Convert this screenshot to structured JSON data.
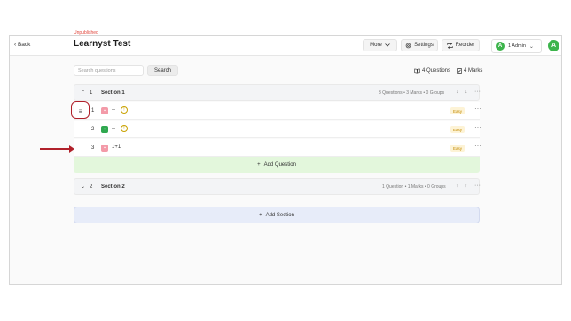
{
  "topbar": {
    "back_label": "‹ Back",
    "admin_initial": "A",
    "admin_label": "1 Admin",
    "admin_chevron": "⌄",
    "user_initial": "A"
  },
  "test": {
    "status": "Unpublished",
    "title": "Learnyst Test"
  },
  "toolbar": {
    "more_label": "More",
    "settings_label": "Settings",
    "reorder_label": "Reorder"
  },
  "search": {
    "placeholder": "Search questions",
    "button_label": "Search"
  },
  "summary": {
    "questions": "4 Questions",
    "marks": "4 Marks"
  },
  "sections": [
    {
      "number": "1",
      "name": "Section 1",
      "meta": "3 Questions • 3 Marks • 0 Groups",
      "questions": [
        {
          "number": "1",
          "type_icon": "pink-question-icon",
          "text": "--",
          "has_warning": true,
          "difficulty": "Easy"
        },
        {
          "number": "2",
          "type_icon": "green-question-icon",
          "text": "--",
          "has_warning": true,
          "difficulty": "Easy"
        },
        {
          "number": "3",
          "type_icon": "pink-question-icon",
          "text": "1+1",
          "has_warning": false,
          "difficulty": "Easy"
        }
      ],
      "add_question_label": "Add Question"
    },
    {
      "number": "2",
      "name": "Section 2",
      "meta": "1 Question • 1 Marks • 0 Groups"
    }
  ],
  "add_section_label": "Add Section",
  "colors": {
    "accent_green": "#3cb44b",
    "annotation_red": "#b0202a",
    "add_question_bg": "#e3f7dc",
    "add_section_bg": "#e7ecf9",
    "easy_badge": "#c28a00"
  }
}
